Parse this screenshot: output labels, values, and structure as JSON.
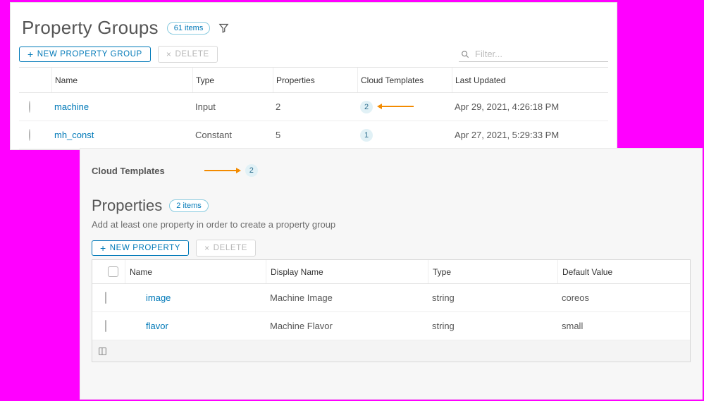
{
  "top": {
    "title": "Property Groups",
    "count_pill": "61 items",
    "btn_new": "New Property Group",
    "btn_delete": "Delete",
    "filter_placeholder": "Filter...",
    "columns": {
      "name": "Name",
      "type": "Type",
      "props": "Properties",
      "ct": "Cloud Templates",
      "updated": "Last Updated"
    },
    "rows": [
      {
        "name": "machine",
        "type": "Input",
        "props": "2",
        "ct": "2",
        "updated": "Apr 29, 2021, 4:26:18 PM"
      },
      {
        "name": "mh_const",
        "type": "Constant",
        "props": "5",
        "ct": "1",
        "updated": "Apr 27, 2021, 5:29:33 PM"
      }
    ]
  },
  "bot": {
    "ct_label": "Cloud Templates",
    "ct_badge": "2",
    "title": "Properties",
    "count_pill": "2 items",
    "desc": "Add at least one property in order to create a property group",
    "btn_new": "New Property",
    "btn_delete": "Delete",
    "columns": {
      "name": "Name",
      "display": "Display Name",
      "type": "Type",
      "default": "Default Value"
    },
    "rows": [
      {
        "name": "image",
        "display": "Machine Image",
        "type": "string",
        "default": "coreos"
      },
      {
        "name": "flavor",
        "display": "Machine Flavor",
        "type": "string",
        "default": "small"
      }
    ]
  }
}
